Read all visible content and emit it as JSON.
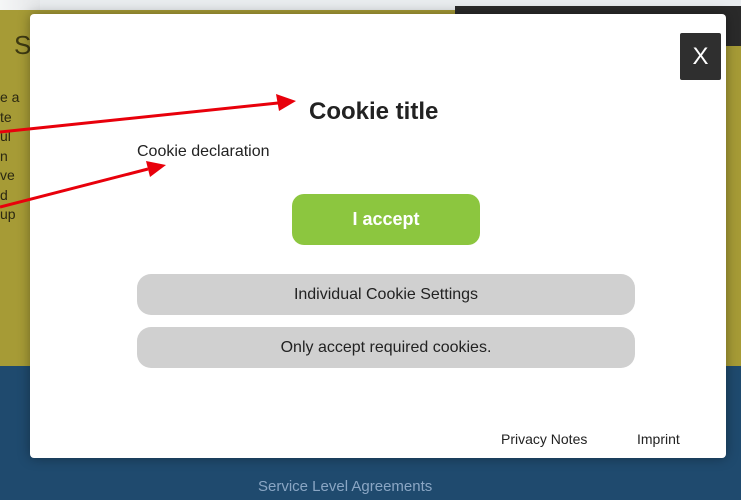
{
  "background": {
    "heading": "S",
    "text_lines": [
      "e a",
      "te",
      "ul",
      "n",
      "ve",
      "d",
      "up"
    ],
    "footer_text": "Service Level Agreements"
  },
  "modal": {
    "close_label": "X",
    "title": "Cookie title",
    "declaration": "Cookie declaration",
    "accept_label": "I accept",
    "individual_settings_label": "Individual Cookie Settings",
    "required_only_label": "Only accept required cookies.",
    "privacy_notes_label": "Privacy Notes",
    "imprint_label": "Imprint"
  },
  "colors": {
    "accept_green": "#8cc63f",
    "annotation_arrow": "#e8000b",
    "overlay_olive": "#a69b36",
    "page_blue": "#1f4a6e"
  }
}
